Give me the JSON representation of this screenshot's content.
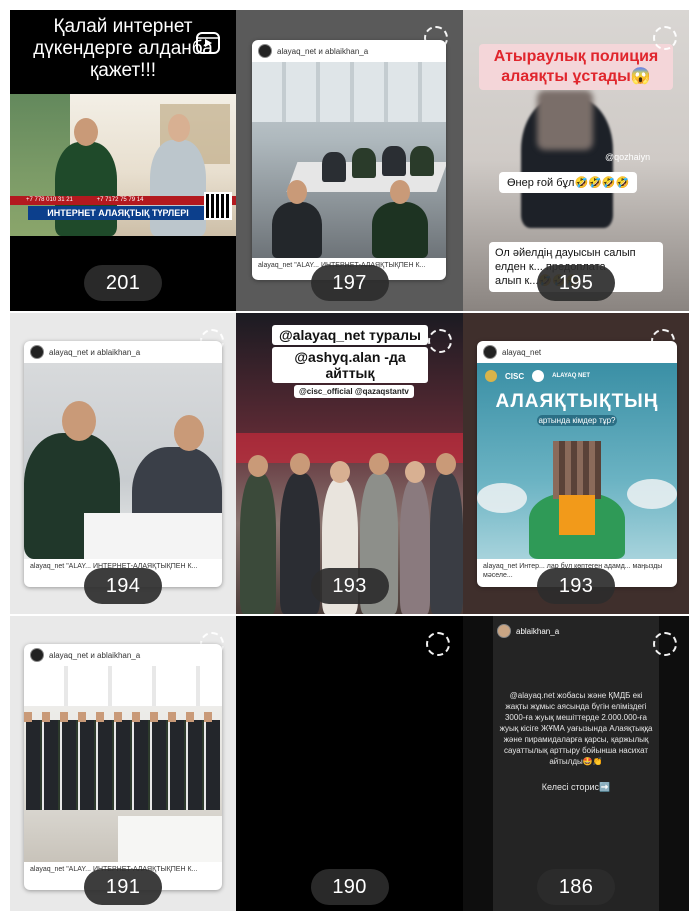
{
  "tiles": [
    {
      "count": "201",
      "headline_line1": "Қалай интернет",
      "headline_line2": "дүкендерге алданба",
      "headline_line3": "қажет!!!",
      "tv_caption": "ИНТЕРНЕТ АЛАЯҚТЫҚ ТҮРЛЕРІ",
      "phone_left": "+7 778 010 31 21",
      "phone_right": "+7 7172 75 79 14"
    },
    {
      "count": "197",
      "account": "alayaq_net и ablaikhan_a",
      "caption": "alayaq_net \"ALAY... ИНТЕРНЕТ-АЛАЯҚТЫҚПЕН К..."
    },
    {
      "count": "195",
      "title": "Атыраулық полиция алаяқты ұстады😱",
      "handle": "@qozhaiyn",
      "sticker1": "Өнер ғой бұл🤣🤣🤣🤣",
      "sticker2_line1": "Ол әйелдің дауысын салып",
      "sticker2_line2": "елден к... предоплата",
      "sticker2_line3": "алып к...🤣🤣🤣"
    },
    {
      "count": "194",
      "account": "alayaq_net и ablaikhan_a",
      "caption": "alayaq_net \"ALAY... ИНТЕРНЕТ-АЛАЯҚТЫҚПЕН К..."
    },
    {
      "count": "193",
      "banner_line1": "@alayaq_net туралы",
      "banner_line2": "@ashyq.alan -да айттық",
      "tags": "@cisc_official @qazaqstantv"
    },
    {
      "count": "193",
      "account": "alayaq_net",
      "logo_text": "CISC",
      "logo_right": "ALAYAQ NET",
      "poster_title": "АЛАЯҚТЫҚТЫҢ",
      "poster_subtitle": "артында кімдер тұр?",
      "caption": "alayaq_net Интер... лар бұл көптеген адамд... маңызды мәселе..."
    },
    {
      "count": "191",
      "account": "alayaq_net и ablaikhan_a",
      "caption": "alayaq_net \"ALAY... ИНТЕРНЕТ-АЛАЯҚТЫҚПЕН К..."
    },
    {
      "count": "190"
    },
    {
      "count": "186",
      "account": "ablaikhan_a",
      "story_text": "@alayaq.net жобасы және ҚМДБ екі жақты жұмыс аясында бүгін еліміздегі 3000-ға жуық мешіттерде 2.000.000-ға жуық кісіге ЖҰМА уағызында Алаяқтыққа және пирамидаларға қарсы, қаржылық сауаттылық арттыру бойынша насихат айтылды🤩👏",
      "next_label": "Келесі сторис➡️"
    }
  ],
  "colors": {
    "count_bg": "#2d2d2d",
    "poster_title": "#ffffff",
    "banner_pink": "#f2a7b0",
    "police_title": "#e52d2d"
  }
}
